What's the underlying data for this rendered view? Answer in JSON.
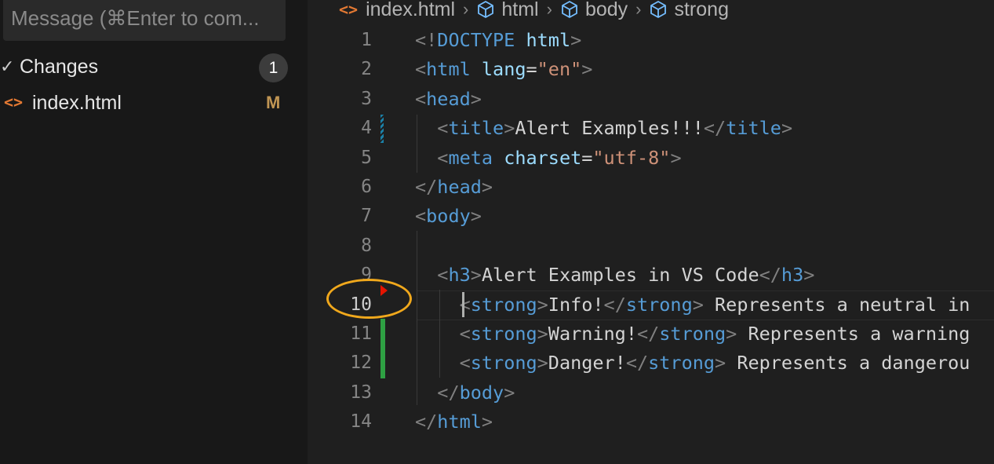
{
  "scm": {
    "message_placeholder": "Message (⌘Enter to com...",
    "changes_label": "Changes",
    "changes_count": "1",
    "files": [
      {
        "name": "index.html",
        "status": "M"
      }
    ]
  },
  "breadcrumb": {
    "file": "index.html",
    "items": [
      "html",
      "body",
      "strong"
    ]
  },
  "code_lines": [
    {
      "n": "1",
      "tokens": [
        [
          "br",
          "<!"
        ],
        [
          "tag",
          "DOCTYPE"
        ],
        [
          "txt",
          " "
        ],
        [
          "attr",
          "html"
        ],
        [
          "br",
          ">"
        ]
      ]
    },
    {
      "n": "2",
      "tokens": [
        [
          "br",
          "<"
        ],
        [
          "tag",
          "html"
        ],
        [
          "txt",
          " "
        ],
        [
          "attr",
          "lang"
        ],
        [
          "txt",
          "="
        ],
        [
          "str",
          "\"en\""
        ],
        [
          "br",
          ">"
        ]
      ]
    },
    {
      "n": "3",
      "tokens": [
        [
          "br",
          "<"
        ],
        [
          "tag",
          "head"
        ],
        [
          "br",
          ">"
        ]
      ]
    },
    {
      "n": "4",
      "tokens": [
        [
          "txt",
          "  "
        ],
        [
          "br",
          "<"
        ],
        [
          "tag",
          "title"
        ],
        [
          "br",
          ">"
        ],
        [
          "txt",
          "Alert Examples!!!"
        ],
        [
          "br",
          "</"
        ],
        [
          "tag",
          "title"
        ],
        [
          "br",
          ">"
        ]
      ]
    },
    {
      "n": "5",
      "tokens": [
        [
          "txt",
          "  "
        ],
        [
          "br",
          "<"
        ],
        [
          "tag",
          "meta"
        ],
        [
          "txt",
          " "
        ],
        [
          "attr",
          "charset"
        ],
        [
          "txt",
          "="
        ],
        [
          "str",
          "\"utf-8\""
        ],
        [
          "br",
          ">"
        ]
      ]
    },
    {
      "n": "6",
      "tokens": [
        [
          "br",
          "</"
        ],
        [
          "tag",
          "head"
        ],
        [
          "br",
          ">"
        ]
      ]
    },
    {
      "n": "7",
      "tokens": [
        [
          "br",
          "<"
        ],
        [
          "tag",
          "body"
        ],
        [
          "br",
          ">"
        ]
      ]
    },
    {
      "n": "8",
      "tokens": []
    },
    {
      "n": "9",
      "tokens": [
        [
          "txt",
          "  "
        ],
        [
          "br",
          "<"
        ],
        [
          "tag",
          "h3"
        ],
        [
          "br",
          ">"
        ],
        [
          "txt",
          "Alert Examples in VS Code"
        ],
        [
          "br",
          "</"
        ],
        [
          "tag",
          "h3"
        ],
        [
          "br",
          ">"
        ]
      ]
    },
    {
      "n": "10",
      "tokens": [
        [
          "txt",
          "    "
        ],
        [
          "br",
          "<"
        ],
        [
          "tag",
          "strong"
        ],
        [
          "br",
          ">"
        ],
        [
          "txt",
          "Info!"
        ],
        [
          "br",
          "</"
        ],
        [
          "tag",
          "strong"
        ],
        [
          "br",
          ">"
        ],
        [
          "txt",
          " Represents a neutral in"
        ]
      ]
    },
    {
      "n": "11",
      "tokens": [
        [
          "txt",
          "    "
        ],
        [
          "br",
          "<"
        ],
        [
          "tag",
          "strong"
        ],
        [
          "br",
          ">"
        ],
        [
          "txt",
          "Warning!"
        ],
        [
          "br",
          "</"
        ],
        [
          "tag",
          "strong"
        ],
        [
          "br",
          ">"
        ],
        [
          "txt",
          " Represents a warning"
        ]
      ]
    },
    {
      "n": "12",
      "tokens": [
        [
          "txt",
          "    "
        ],
        [
          "br",
          "<"
        ],
        [
          "tag",
          "strong"
        ],
        [
          "br",
          ">"
        ],
        [
          "txt",
          "Danger!"
        ],
        [
          "br",
          "</"
        ],
        [
          "tag",
          "strong"
        ],
        [
          "br",
          ">"
        ],
        [
          "txt",
          " Represents a dangerou"
        ]
      ]
    },
    {
      "n": "13",
      "tokens": [
        [
          "txt",
          "  "
        ],
        [
          "br",
          "</"
        ],
        [
          "tag",
          "body"
        ],
        [
          "br",
          ">"
        ]
      ]
    },
    {
      "n": "14",
      "tokens": [
        [
          "br",
          "</"
        ],
        [
          "tag",
          "html"
        ],
        [
          "br",
          ">"
        ]
      ]
    }
  ],
  "active_line": "10",
  "colors": {
    "tag": "#569cd6",
    "attribute": "#9cdcfe",
    "string": "#ce9178",
    "bracket": "#808080",
    "added_gutter": "#2ea043",
    "modified_gutter": "#1b81a8",
    "highlight_ring": "#f0a81c"
  }
}
